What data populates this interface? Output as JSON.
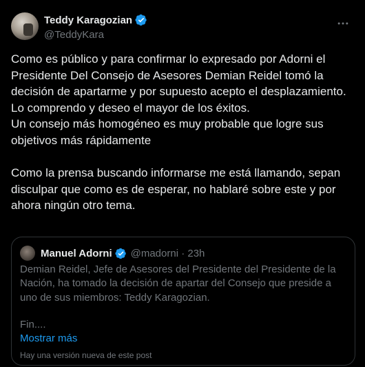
{
  "author": {
    "display_name": "Teddy Karagozian",
    "handle": "@TeddyKara",
    "verified_color": "#1d9bf0"
  },
  "menu": {
    "icon": "more-horizontal-icon"
  },
  "post": {
    "paragraph1": "Como es público y para confirmar lo expresado por Adorni el Presidente Del Consejo de Asesores Demian Reidel tomó la decisión de apartarme y por supuesto acepto el desplazamiento.",
    "paragraph2": "Lo comprendo y deseo el mayor de los éxitos.",
    "paragraph3": "Un consejo más homogéneo es muy probable que logre sus objetivos más rápidamente",
    "paragraph4": "Como la prensa buscando informarse me está llamando, sepan disculpar que como es de esperar, no hablaré sobre este y por ahora ningún otro tema."
  },
  "quoted": {
    "display_name": "Manuel Adorni",
    "handle_time": "@madorni · 23h",
    "text": "Demian Reidel, Jefe de Asesores del Presidente del Presidente de la Nación, ha tomado la decisión de apartar del Consejo que preside a uno de sus miembros: Teddy Karagozian.",
    "fin": "Fin....",
    "show_more": "Mostrar más",
    "new_version_note": "Hay una versión nueva de este post"
  },
  "colors": {
    "background": "#000000",
    "text": "#e7e9ea",
    "secondary": "#71767b",
    "accent": "#1d9bf0",
    "border": "#2f3336"
  }
}
